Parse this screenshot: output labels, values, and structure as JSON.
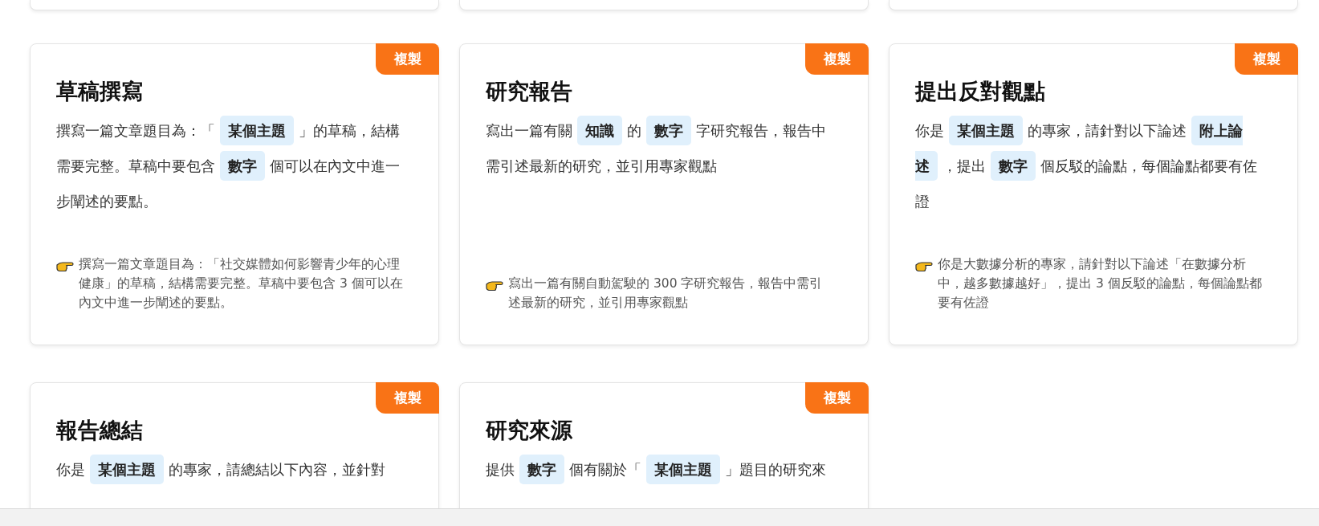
{
  "cards": [
    {
      "title": "草稿撰寫",
      "copy_label": "複製",
      "body": [
        {
          "kind": "text",
          "text": "撰寫一篇文章題目為：「"
        },
        {
          "kind": "tag",
          "text": "某個主題"
        },
        {
          "kind": "text",
          "text": "」的草稿，結構需要完整。草稿中要包含"
        },
        {
          "kind": "tag",
          "text": "數字"
        },
        {
          "kind": "text",
          "text": "個可以在內文中進一步闡述的要點。"
        }
      ],
      "example": "撰寫一篇文章題目為：「社交媒體如何影響青少年的心理健康」的草稿，結構需要完整。草稿中要包含 3 個可以在內文中進一步闡述的要點。"
    },
    {
      "title": "研究報告",
      "copy_label": "複製",
      "body": [
        {
          "kind": "text",
          "text": "寫出一篇有關"
        },
        {
          "kind": "tag",
          "text": "知識"
        },
        {
          "kind": "text",
          "text": "的"
        },
        {
          "kind": "tag",
          "text": "數字"
        },
        {
          "kind": "text",
          "text": "字研究報告，報告中需引述最新的研究，並引用專家觀點"
        }
      ],
      "example": "寫出一篇有關自動駕駛的 300 字研究報告，報告中需引述最新的研究，並引用專家觀點"
    },
    {
      "title": "提出反對觀點",
      "copy_label": "複製",
      "body": [
        {
          "kind": "text",
          "text": "你是"
        },
        {
          "kind": "tag",
          "text": "某個主題"
        },
        {
          "kind": "text",
          "text": "的專家，請針對以下論述"
        },
        {
          "kind": "tag",
          "text": "附上論述"
        },
        {
          "kind": "text",
          "text": "，提出"
        },
        {
          "kind": "tag",
          "text": "數字"
        },
        {
          "kind": "text",
          "text": "個反駁的論點，每個論點都要有佐證"
        }
      ],
      "example": "你是大數據分析的專家，請針對以下論述「在數據分析中，越多數據越好」，提出 3 個反駁的論點，每個論點都要有佐證"
    },
    {
      "title": "報告總結",
      "copy_label": "複製",
      "body": [
        {
          "kind": "text",
          "text": "你是"
        },
        {
          "kind": "tag",
          "text": "某個主題"
        },
        {
          "kind": "text",
          "text": "的專家，請總結以下內容，並針對"
        }
      ]
    },
    {
      "title": "研究來源",
      "copy_label": "複製",
      "body": [
        {
          "kind": "text",
          "text": "提供"
        },
        {
          "kind": "tag",
          "text": "數字"
        },
        {
          "kind": "text",
          "text": "個有關於「"
        },
        {
          "kind": "tag",
          "text": "某個主題"
        },
        {
          "kind": "text",
          "text": "」題目的研究來"
        }
      ]
    }
  ]
}
